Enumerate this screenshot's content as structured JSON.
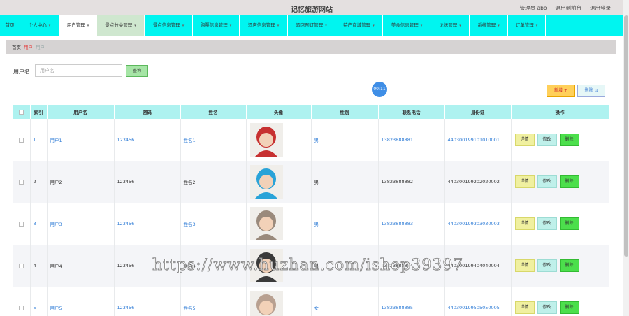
{
  "header": {
    "site_title": "记忆旅游网站",
    "user_label": "管理员 abo",
    "back_to_front": "退出到前台",
    "logout": "退出登录"
  },
  "nav": {
    "items": [
      {
        "label": "首页",
        "has_dropdown": false
      },
      {
        "label": "个人中心",
        "has_dropdown": true
      },
      {
        "label": "用户管理",
        "has_dropdown": true,
        "state": "active"
      },
      {
        "label": "景点分类管理",
        "has_dropdown": true,
        "state": "hover"
      },
      {
        "label": "景点信息管理",
        "has_dropdown": true
      },
      {
        "label": "购票信息管理",
        "has_dropdown": true
      },
      {
        "label": "酒店信息管理",
        "has_dropdown": true
      },
      {
        "label": "酒店预订管理",
        "has_dropdown": true
      },
      {
        "label": "特产商城管理",
        "has_dropdown": true
      },
      {
        "label": "美食信息管理",
        "has_dropdown": true
      },
      {
        "label": "论坛管理",
        "has_dropdown": true
      },
      {
        "label": "系统管理",
        "has_dropdown": true
      },
      {
        "label": "订单管理",
        "has_dropdown": true
      }
    ],
    "chevron": "▾"
  },
  "breadcrumb": {
    "home": "首页",
    "level2": "用户",
    "level3": "用户"
  },
  "search": {
    "label": "用户名",
    "placeholder": "用户名",
    "value": "",
    "button": "查询"
  },
  "pagination_indicator": "00:11",
  "actions": {
    "add": "新增 +",
    "delete": "删除 ⊡"
  },
  "table": {
    "columns": [
      "索引",
      "用户名",
      "密码",
      "姓名",
      "头像",
      "性别",
      "联系电话",
      "身份证",
      "操作"
    ],
    "rows": [
      {
        "index": "1",
        "username": "用户1",
        "password": "123456",
        "name": "姓名1",
        "gender": "男",
        "phone": "13823888881",
        "id_card": "440300199101010001",
        "avatar_color": "#c73131"
      },
      {
        "index": "2",
        "username": "用户2",
        "password": "123456",
        "name": "姓名2",
        "gender": "男",
        "phone": "13823888882",
        "id_card": "440300199202020002",
        "avatar_color": "#29a3d8"
      },
      {
        "index": "3",
        "username": "用户3",
        "password": "123456",
        "name": "姓名3",
        "gender": "男",
        "phone": "13823888883",
        "id_card": "440300199303030003",
        "avatar_color": "#9a8a7c"
      },
      {
        "index": "4",
        "username": "用户4",
        "password": "123456",
        "name": "姓名4",
        "gender": "男",
        "phone": "13823888884",
        "id_card": "440300199404040004",
        "avatar_color": "#3a3a3a"
      },
      {
        "index": "5",
        "username": "用户5",
        "password": "123456",
        "name": "姓名5",
        "gender": "女",
        "phone": "13823888885",
        "id_card": "440300199505050005",
        "avatar_color": "#b8a090"
      }
    ],
    "row_actions": {
      "detail": "详情",
      "edit": "修改",
      "remove": "删除"
    }
  },
  "watermark": "https://www.huzhan.com/ishop39397"
}
